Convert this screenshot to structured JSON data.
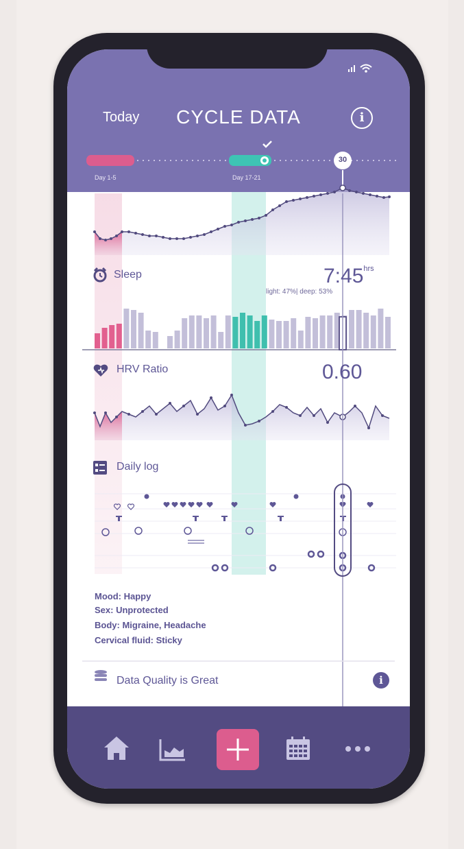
{
  "header": {
    "today_label": "Today",
    "title": "CYCLE DATA"
  },
  "timeline": {
    "period_label": "Day 1-5",
    "fertile_label": "Day 17-21",
    "current_day": "30"
  },
  "sleep": {
    "label": "Sleep",
    "value": "7:45",
    "unit": "hrs",
    "detail": "light: 47%| deep: 53%"
  },
  "hrv": {
    "label": "HRV Ratio",
    "value": "0.60"
  },
  "daily_log": {
    "label": "Daily log",
    "entries": [
      {
        "key": "Mood:",
        "value": "Happy"
      },
      {
        "key": "Sex:",
        "value": "Unprotected"
      },
      {
        "key": "Body:",
        "value": "Migraine, Headache"
      },
      {
        "key": "Cervical fluid:",
        "value": "Sticky"
      }
    ]
  },
  "data_quality": {
    "label": "Data Quality is Great"
  },
  "tabbar": {
    "items": [
      "home-icon",
      "chart-icon",
      "add-icon",
      "calendar-icon",
      "more-icon"
    ]
  },
  "colors": {
    "header_bg": "#7a72b0",
    "tabbar_bg": "#534b82",
    "period": "#dc5d8e",
    "fertile": "#3ec4b4",
    "text": "#5e5796"
  }
}
